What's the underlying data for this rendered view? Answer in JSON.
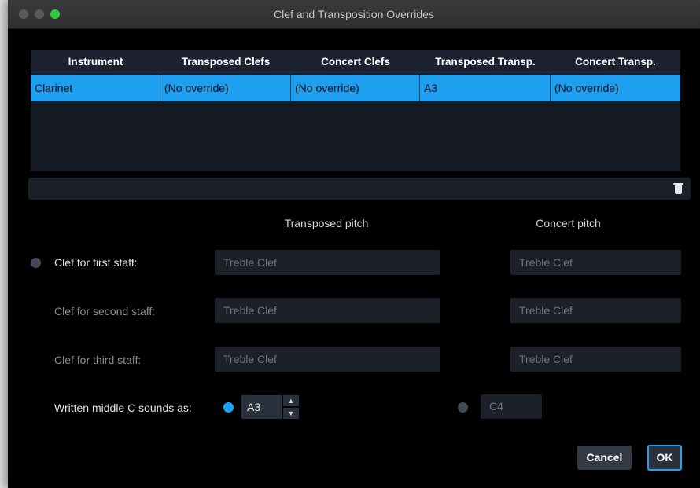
{
  "window": {
    "title": "Clef and Transposition Overrides"
  },
  "table": {
    "columns": [
      "Instrument",
      "Transposed Clefs",
      "Concert Clefs",
      "Transposed Transp.",
      "Concert Transp."
    ],
    "rows": [
      [
        "Clarinet",
        "(No override)",
        "(No override)",
        "A3",
        "(No override)"
      ]
    ]
  },
  "sections": {
    "transposed_heading": "Transposed pitch",
    "concert_heading": "Concert pitch"
  },
  "clefs": {
    "first": {
      "label": "Clef for first staff:",
      "transposed": "Treble Clef",
      "concert": "Treble Clef"
    },
    "second": {
      "label": "Clef for second staff:",
      "transposed": "Treble Clef",
      "concert": "Treble Clef"
    },
    "third": {
      "label": "Clef for third staff:",
      "transposed": "Treble Clef",
      "concert": "Treble Clef"
    }
  },
  "middle_c": {
    "label": "Written middle C sounds as:",
    "transposed_value": "A3",
    "concert_value": "C4"
  },
  "buttons": {
    "cancel": "Cancel",
    "ok": "OK"
  },
  "colors": {
    "accent": "#1ea3f4",
    "selection": "#1e9ff0",
    "background": "#000000"
  },
  "icons": {
    "delete": "trash-icon",
    "step_up": "chevron-up-icon",
    "step_down": "chevron-down-icon"
  }
}
